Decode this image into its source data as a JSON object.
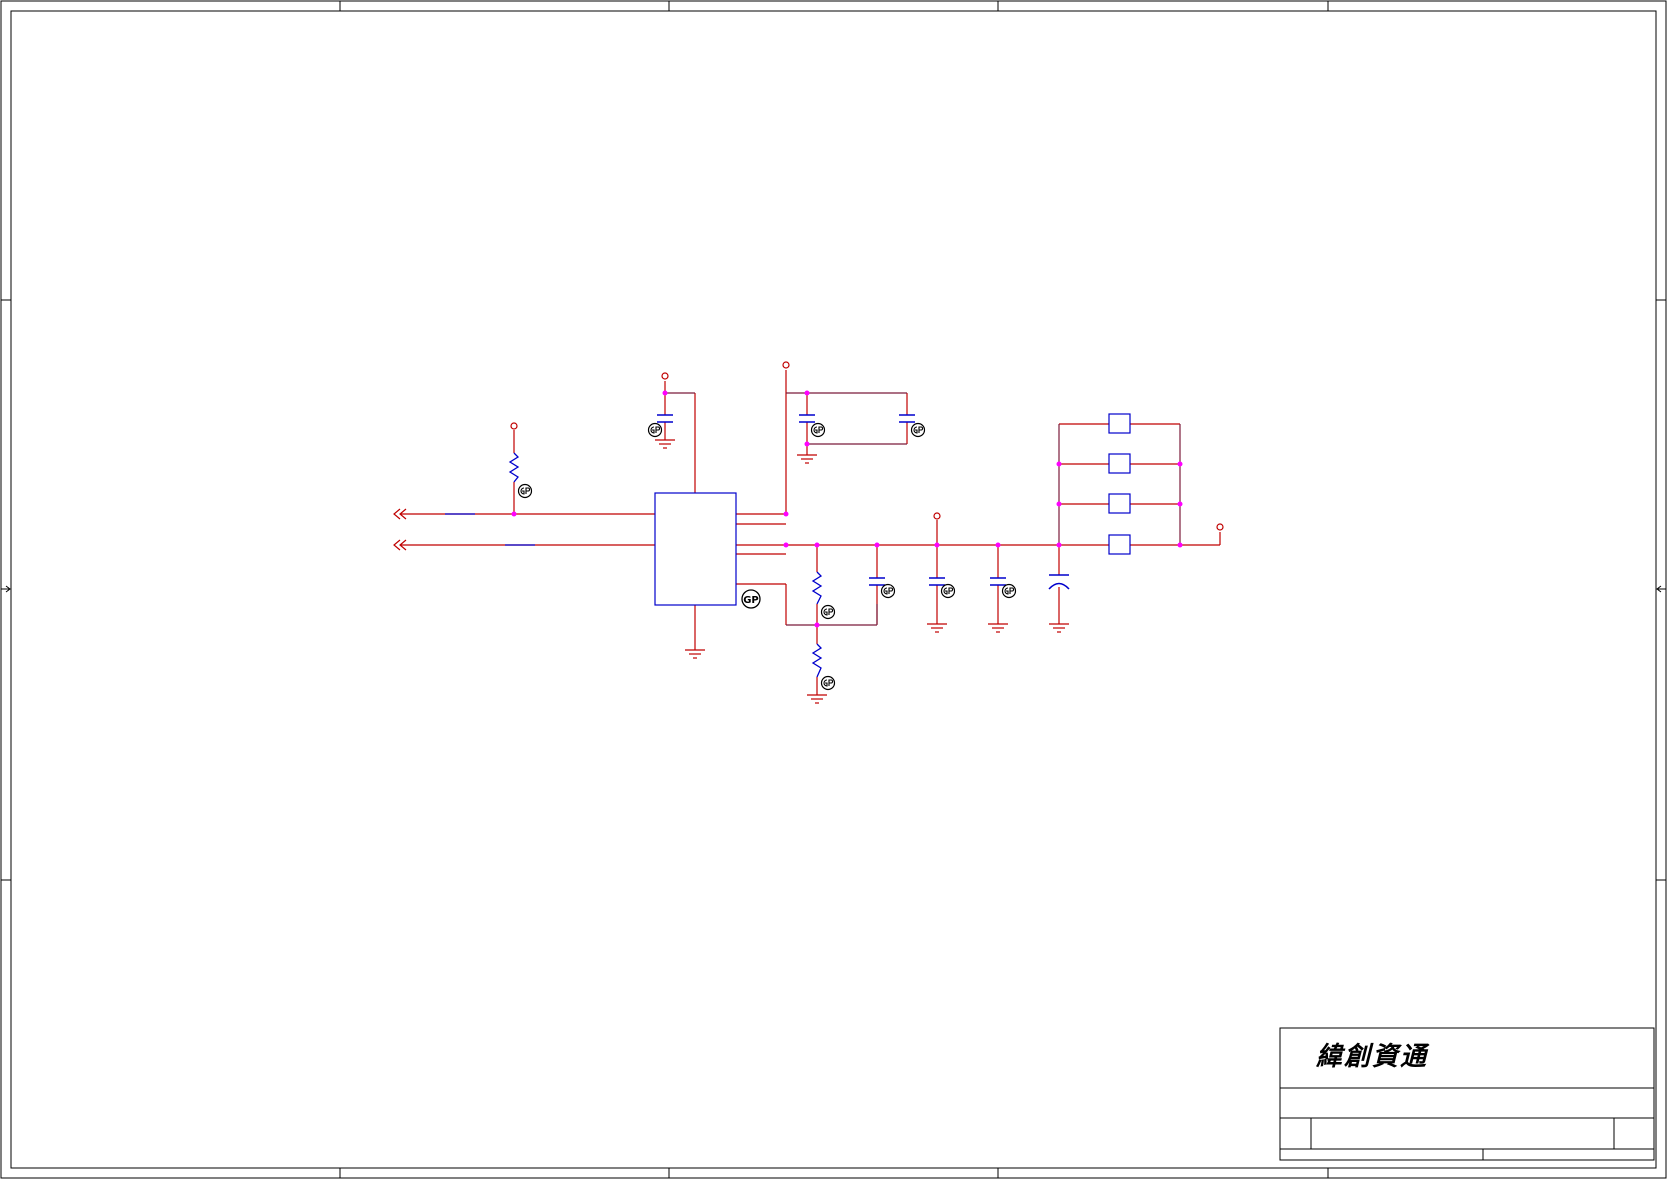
{
  "title_block": {
    "company": "緯創資通"
  },
  "badges": {
    "gp_label": "GP"
  },
  "colors": {
    "wire": "#c00000",
    "net": "#7a1a3a",
    "component": "#0000cc",
    "junction": "#ff00ff",
    "frame": "#000000"
  }
}
